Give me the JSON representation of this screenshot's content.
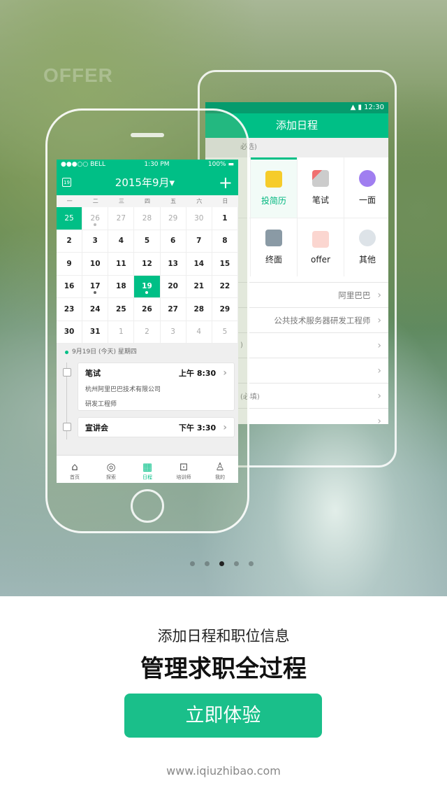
{
  "background": {
    "watermark": "OFFER"
  },
  "android": {
    "status_time": "12:30",
    "title": "添加日程",
    "section_hint": "必选)",
    "types": [
      {
        "label": "",
        "icon": "hidden"
      },
      {
        "label": "投简历",
        "icon": "document-icon",
        "selected": true
      },
      {
        "label": "笔试",
        "icon": "pencil-icon"
      },
      {
        "label": "一面",
        "icon": "chat-icon"
      },
      {
        "label": "",
        "icon": "hidden"
      },
      {
        "label": "终面",
        "icon": "people-icon"
      },
      {
        "label": "offer",
        "icon": "star-paper-icon"
      },
      {
        "label": "其他",
        "icon": "more-icon"
      }
    ],
    "rows": [
      {
        "label": "",
        "value": "阿里巴巴"
      },
      {
        "label": "",
        "value": "公共技术服务器研发工程师"
      },
      {
        "label": ")",
        "value": ""
      },
      {
        "label": "",
        "value": ""
      },
      {
        "label": "(必填)",
        "value": ""
      },
      {
        "label": "",
        "value": ""
      }
    ]
  },
  "iphone": {
    "status": {
      "carrier": "●●●○○ BELL",
      "time": "1:30 PM",
      "battery": "100%"
    },
    "header": {
      "calendar_icon_day": "19",
      "title": "2015年9月▾",
      "add": "+"
    },
    "weekdays": [
      "一",
      "二",
      "三",
      "四",
      "五",
      "六",
      "日"
    ],
    "days": [
      [
        "25",
        1,
        1
      ],
      [
        "26",
        1,
        0,
        1
      ],
      [
        "27",
        1
      ],
      [
        "28",
        1
      ],
      [
        "29",
        1
      ],
      [
        "30",
        1
      ],
      [
        "1"
      ],
      [
        "2"
      ],
      [
        "3"
      ],
      [
        "4"
      ],
      [
        "5"
      ],
      [
        "6"
      ],
      [
        "7"
      ],
      [
        "8"
      ],
      [
        "9"
      ],
      [
        "10"
      ],
      [
        "11"
      ],
      [
        "12"
      ],
      [
        "13"
      ],
      [
        "14"
      ],
      [
        "15"
      ],
      [
        "16"
      ],
      [
        "17",
        0,
        0,
        1
      ],
      [
        "18"
      ],
      [
        "19",
        0,
        1,
        1
      ],
      [
        "20"
      ],
      [
        "21"
      ],
      [
        "22"
      ],
      [
        "23"
      ],
      [
        "24"
      ],
      [
        "25"
      ],
      [
        "26"
      ],
      [
        "27"
      ],
      [
        "28"
      ],
      [
        "29"
      ],
      [
        "30"
      ],
      [
        "31"
      ],
      [
        "1",
        1
      ],
      [
        "2",
        1
      ],
      [
        "3",
        1
      ],
      [
        "4",
        1
      ],
      [
        "5",
        1
      ]
    ],
    "selected_date": "9月19日 (今天)  星期四",
    "events": [
      {
        "title": "笔试",
        "time": "上午 8:30",
        "company": "杭州阿里巴巴技术有限公司",
        "position": "研发工程师"
      },
      {
        "title": "宣讲会",
        "time": "下午 3:30"
      }
    ],
    "tabs": [
      {
        "label": "首页",
        "icon": "⌂"
      },
      {
        "label": "探索",
        "icon": "◎"
      },
      {
        "label": "日程",
        "icon": "▦",
        "active": true
      },
      {
        "label": "培训师",
        "icon": "⊡"
      },
      {
        "label": "我的",
        "icon": "♙"
      }
    ]
  },
  "pager": {
    "count": 5,
    "active": 3
  },
  "promo": {
    "subtitle": "添加日程和职位信息",
    "headline": "管理求职全过程",
    "cta": "立即体验",
    "url": "www.iqiuzhibao.com"
  },
  "colors": {
    "accent": "#00bf86",
    "button": "#1abf8a"
  }
}
